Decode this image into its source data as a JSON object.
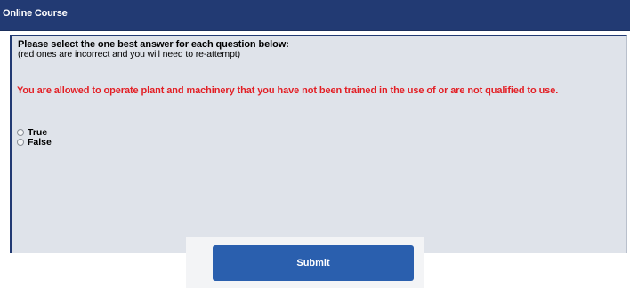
{
  "header": {
    "title": "Online Course"
  },
  "instructions": {
    "main": "Please select the one best answer for each question below:",
    "sub": "(red ones are incorrect and you will need to re-attempt)"
  },
  "question": {
    "text": "You are allowed to operate plant and machinery that you have not been trained in the use of or are not qualified to use.",
    "status": "incorrect",
    "options": [
      "True",
      "False"
    ]
  },
  "form": {
    "submit_label": "Submit"
  },
  "colors": {
    "header_bg": "#223a73",
    "panel_bg": "#dfe3ea",
    "incorrect_text": "#e31e24",
    "button_bg": "#2a5fae"
  }
}
